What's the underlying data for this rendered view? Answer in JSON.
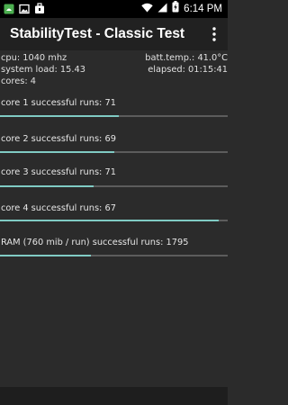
{
  "status_bar": {
    "time": "6:14 PM",
    "left_icons": [
      "android-debug-icon",
      "image-icon",
      "briefcase-icon"
    ],
    "right_icons": [
      "wifi-icon",
      "signal-icon",
      "battery-charging-icon"
    ]
  },
  "app_bar": {
    "title": "StabilityTest - Classic Test",
    "overflow_icon": "more-vert-icon"
  },
  "stats": {
    "cpu": "cpu: 1040 mhz",
    "batt_temp": "batt.temp.: 41.0°C",
    "system_load": "system load: 15.43",
    "elapsed": "elapsed: 01:15:41",
    "cores": "cores: 4"
  },
  "progress": [
    {
      "label": "core 1 successful runs: 71",
      "value": 0.52
    },
    {
      "label": "core 2 successful runs: 69",
      "value": 0.5
    },
    {
      "label": "core 3 successful runs: 71",
      "value": 0.41
    },
    {
      "label": "core 4 successful runs: 67",
      "value": 0.96
    },
    {
      "label": "RAM (760 mib / run) successful runs: 1795",
      "value": 0.4
    }
  ],
  "colors": {
    "background": "#2b2b2b",
    "app_bar": "#212121",
    "progress_fill": "#80cbc4",
    "progress_track": "#5c5c5c"
  }
}
